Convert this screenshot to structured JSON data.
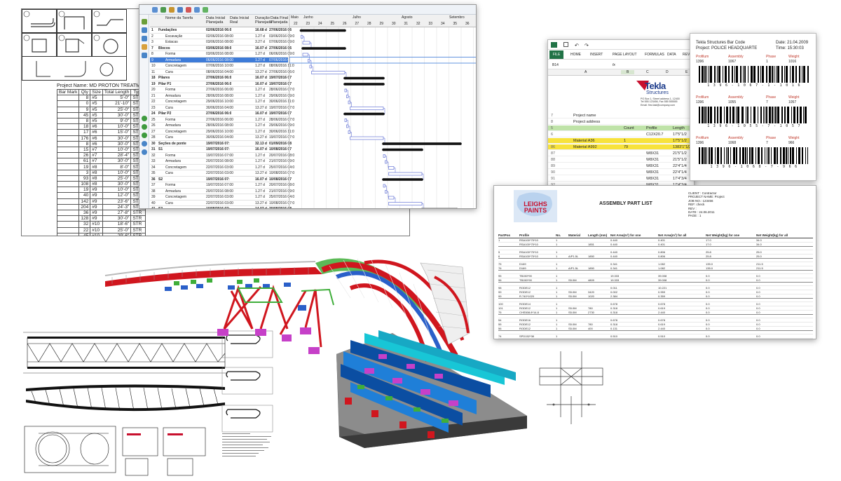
{
  "rebar_schedule": {
    "project_label": "Project Name:  MD PROTON TREATMENT CE",
    "headers": [
      "Bar Mark",
      "Qty",
      "Size",
      "Total Length",
      "Type"
    ],
    "rows": [
      [
        "",
        "8",
        "#5",
        "5'-0\"",
        "STR"
      ],
      [
        "",
        "0",
        "#5",
        "21'-10\"",
        "STR"
      ],
      [
        "",
        "9",
        "#5",
        "25'-0\"",
        "STR"
      ],
      [
        "",
        "45",
        "#5",
        "30'-0\"",
        "STR"
      ],
      [
        "",
        "8",
        "#5",
        "9'-0\"",
        "STR"
      ],
      [
        "",
        "18",
        "#6",
        "10'-0\"",
        "STR"
      ],
      [
        "",
        "17",
        "#6",
        "15'-0\"",
        "STR"
      ],
      [
        "",
        "176",
        "#6",
        "30'-0\"",
        "STR"
      ],
      [
        "",
        "8",
        "#6",
        "30'-0\"",
        "STR"
      ],
      [
        "",
        "15",
        "#7",
        "10'-0\"",
        "STR"
      ],
      [
        "",
        "26",
        "#7",
        "28'-4\"",
        "STR"
      ],
      [
        "",
        "61",
        "#7",
        "30'-0\"",
        "STR"
      ],
      [
        "",
        "19",
        "#8",
        "8'-0\"",
        "STR"
      ],
      [
        "",
        "3",
        "#8",
        "10'-0\"",
        "STR"
      ],
      [
        "",
        "93",
        "#8",
        "25'-0\"",
        "STR"
      ],
      [
        "",
        "108",
        "#8",
        "30'-0\"",
        "STR"
      ],
      [
        "",
        "19",
        "#9",
        "10'-0\"",
        "STR"
      ],
      [
        "",
        "40",
        "#9",
        "12'-0\"",
        "STR"
      ],
      [
        "",
        "142",
        "#9",
        "23'-6\"",
        "STR"
      ],
      [
        "",
        "204",
        "#9",
        "24'-3\"",
        "STR"
      ],
      [
        "",
        "36",
        "#9",
        "27'-8\"",
        "STR"
      ],
      [
        "",
        "128",
        "#9",
        "30'-0\"",
        "STR"
      ],
      [
        "",
        "32",
        "#10",
        "18'-6\"",
        "STR"
      ],
      [
        "",
        "22",
        "#10",
        "25'-0\"",
        "STR"
      ],
      [
        "",
        "45",
        "#10",
        "29'-6\"",
        "STR"
      ],
      [
        "G407",
        "10",
        "#4",
        "17'-9\"",
        "S10"
      ],
      [
        "G703",
        "12",
        "#7",
        "8'-2\"",
        "G703"
      ],
      [
        "G702",
        "9",
        "#7",
        "15'-7 1/2\"",
        "STR"
      ],
      [
        "G1004",
        "66",
        "#10",
        "22'-10\"",
        "STR"
      ],
      [
        "G1005",
        "18",
        "#10",
        "16'-7 1/2\"",
        "STR"
      ]
    ],
    "extra_cols": {
      "G703": [
        "1'-2\"",
        "-0\"",
        "2'-0\"",
        "5'-1 1/4\"",
        "5'-0\"",
        "",
        "",
        "0'-2 5/8\""
      ],
      "G702": [
        "",
        "",
        "",
        "",
        "",
        "3'-11 1/2\"",
        "4'-0\"",
        "0'-2 5/8\""
      ],
      "G1004": [
        "1'-10\"",
        "21'-0\"",
        "",
        "",
        "",
        "",
        "",
        "0'-5 3/8\""
      ],
      "G1005": [
        "",
        "5'-6\"",
        "5'-7 1/2\"",
        "5'-6\"",
        "",
        "4'-0\"",
        "4'-0\"",
        "0'-5 3/8\""
      ]
    }
  },
  "gantt": {
    "columns": [
      "Nome da Tarefa",
      "Data Inicial Planejada",
      "Data Inicial Real",
      "Duração Planejada",
      "Data Final Planejada"
    ],
    "months": [
      "Maio",
      "Junho",
      "Julho",
      "Agosto",
      "Setembro"
    ],
    "weeks": [
      "22",
      "23",
      "24",
      "25",
      "26",
      "27",
      "28",
      "29",
      "30",
      "31",
      "32",
      "33",
      "34",
      "35",
      "36"
    ],
    "rows": [
      {
        "id": "1",
        "name": "Fundações",
        "start": "02/06/2016 06:0",
        "dur": "16.68 d",
        "end": "27/06/2016 06",
        "sum": true
      },
      {
        "id": "2",
        "name": "Escavação",
        "start": "02/06/2016 08:00",
        "dur": "1.27 d",
        "end": "03/06/2016 09:0"
      },
      {
        "id": "3",
        "name": "Estacas",
        "start": "03/06/2016 08:00",
        "dur": "3.27 d",
        "end": "07/06/2016 09:0"
      },
      {
        "id": "7",
        "name": "Blocos",
        "start": "03/06/2016 08:0",
        "dur": "16.07 d",
        "end": "27/06/2016 06",
        "sum": true
      },
      {
        "id": "8",
        "name": "Forma",
        "start": "03/06/2016 08:00",
        "dur": "1.27 d",
        "end": "06/06/2016 09:0"
      },
      {
        "id": "9",
        "name": "Armadura",
        "start": "06/06/2016 08:00",
        "dur": "1.27 d",
        "end": "07/06/2016 09:0",
        "sel": true
      },
      {
        "id": "10",
        "name": "Concretagem",
        "start": "07/06/2016 10:00",
        "dur": "1.27 d",
        "end": "08/06/2016 11:0"
      },
      {
        "id": "11",
        "name": "Cura",
        "start": "08/06/2016 04:00",
        "dur": "13.27 d",
        "end": "27/06/2016 06:0"
      },
      {
        "id": "18",
        "name": "Pilares",
        "start": "27/06/2016 06:0",
        "dur": "16.07 d",
        "end": "19/07/2016 07",
        "sum": true
      },
      {
        "id": "19",
        "name": "Pilar P1",
        "start": "27/06/2016 06:0",
        "dur": "16.07 d",
        "end": "19/07/2016 07",
        "sum": true
      },
      {
        "id": "20",
        "name": "Forma",
        "start": "27/06/2016 06:00",
        "dur": "1.27 d",
        "end": "28/06/2016 07:0"
      },
      {
        "id": "21",
        "name": "Armadura",
        "start": "28/06/2016 08:00",
        "dur": "1.27 d",
        "end": "29/06/2016 09:0"
      },
      {
        "id": "22",
        "name": "Concretagem",
        "start": "29/06/2016 10:00",
        "dur": "1.27 d",
        "end": "30/06/2016 11:0"
      },
      {
        "id": "23",
        "name": "Cura",
        "start": "30/06/2016 04:00",
        "dur": "13.27 d",
        "end": "19/07/2016 07:0"
      },
      {
        "id": "24",
        "name": "Pilar P2",
        "start": "27/06/2016 06:0",
        "dur": "16.07 d",
        "end": "19/07/2016 07",
        "sum": true
      },
      {
        "id": "25",
        "name": "Forma",
        "start": "27/06/2016 06:00",
        "dur": "1.27 d",
        "end": "28/06/2016 07:0"
      },
      {
        "id": "26",
        "name": "Armadura",
        "start": "28/06/2016 08:00",
        "dur": "1.27 d",
        "end": "29/06/2016 09:0"
      },
      {
        "id": "27",
        "name": "Concretagem",
        "start": "29/06/2016 10:00",
        "dur": "1.27 d",
        "end": "30/06/2016 11:0"
      },
      {
        "id": "28",
        "name": "Cura",
        "start": "30/06/2016 04:00",
        "dur": "13.27 d",
        "end": "19/07/2016 07:0"
      },
      {
        "id": "30",
        "name": "Seções de ponte",
        "start": "19/07/2016 07:",
        "dur": "32.13 d",
        "end": "01/09/2016 08",
        "sum": true
      },
      {
        "id": "31",
        "name": "S1",
        "start": "19/07/2016 07:",
        "dur": "16.07 d",
        "end": "10/08/2016 07",
        "sum": true
      },
      {
        "id": "32",
        "name": "Forma",
        "start": "19/07/2016 07:00",
        "dur": "1.27 d",
        "end": "20/07/2016 08:0"
      },
      {
        "id": "33",
        "name": "Armadura",
        "start": "20/07/2016 08:00",
        "dur": "1.27 d",
        "end": "21/07/2016 09:0"
      },
      {
        "id": "34",
        "name": "Concretagem",
        "start": "22/07/2016 03:00",
        "dur": "1.27 d",
        "end": "25/07/2016 04:0"
      },
      {
        "id": "35",
        "name": "Cura",
        "start": "22/07/2016 03:00",
        "dur": "13.27 d",
        "end": "10/08/2016 07:0"
      },
      {
        "id": "36",
        "name": "S2",
        "start": "19/07/2016 07:",
        "dur": "16.07 d",
        "end": "10/08/2016 07",
        "sum": true
      },
      {
        "id": "37",
        "name": "Forma",
        "start": "19/07/2016 07:00",
        "dur": "1.27 d",
        "end": "20/07/2016 08:0"
      },
      {
        "id": "38",
        "name": "Armadura",
        "start": "20/07/2016 08:00",
        "dur": "1.27 d",
        "end": "21/07/2016 09:0"
      },
      {
        "id": "39",
        "name": "Concretagem",
        "start": "22/07/2016 03:00",
        "dur": "1.27 d",
        "end": "25/07/2016 04:0"
      },
      {
        "id": "40",
        "name": "Cura",
        "start": "22/07/2016 03:00",
        "dur": "13.27 d",
        "end": "10/08/2016 07:0"
      },
      {
        "id": "41",
        "name": "S3",
        "start": "10/08/2016 07:",
        "dur": "14.07 d",
        "end": "30/08/2016 08",
        "sum": true
      },
      {
        "id": "42",
        "name": "Forma",
        "start": "10/08/2016 07:00",
        "dur": "1.27 d",
        "end": "11/08/2016 08:0"
      },
      {
        "id": "43",
        "name": "Armadura",
        "start": "11/08/2016 08:00",
        "dur": "1.27 d",
        "end": "12/08/2016 09:0"
      },
      {
        "id": "44",
        "name": "Concretagem",
        "start": "12/08/2016 10:00",
        "dur": "1.27 d",
        "end": "15/08/2016 11:0"
      },
      {
        "id": "45",
        "name": "Cura",
        "start": "15/08/2016 04:00",
        "dur": "13.27 d",
        "end": "30/08/2016 08:0"
      }
    ]
  },
  "excel": {
    "file_tab": "FILE",
    "tabs": [
      "HOME",
      "INSERT",
      "PAGE LAYOUT",
      "FORMULAS",
      "DATA",
      "REV"
    ],
    "name_box": "B14",
    "fx": "fx",
    "columns": [
      "A",
      "B",
      "C",
      "D",
      "E"
    ],
    "brand": "Tekla",
    "brand_sub": "Structures",
    "address": [
      "PO Box 1, Street address 1, 12400",
      "Tel 555 123456, Fax 555 555555",
      "Email: first.last@company.com"
    ],
    "rows": [
      {
        "n": "7",
        "cells": [
          "Project name"
        ]
      },
      {
        "n": "8",
        "cells": [
          "Project address"
        ]
      },
      {
        "n": "5",
        "cells": [
          "",
          "Count",
          "Profile",
          "Length",
          "Width"
        ],
        "style": "grn"
      },
      {
        "n": "6",
        "cells": [
          "",
          "",
          "C12X20.7",
          "17'5\"1/2",
          "1,3"
        ]
      },
      {
        "n": "",
        "cells": [
          "Material  A36",
          "1",
          "",
          "17'5\"1/2",
          "1,3"
        ],
        "style": "yel"
      },
      {
        "n": "86",
        "cells": [
          "Material  A992",
          "79",
          "",
          "1383'1\"1/2",
          "93,7"
        ],
        "style": "yel"
      },
      {
        "n": "87",
        "cells": [
          "",
          "",
          "W8X31",
          "21'5\"1/2",
          ""
        ]
      },
      {
        "n": "88",
        "cells": [
          "",
          "",
          "W8X31",
          "21'5\"1/2",
          ""
        ]
      },
      {
        "n": "89",
        "cells": [
          "",
          "",
          "W8X31",
          "22'4\"1/4",
          ""
        ]
      },
      {
        "n": "90",
        "cells": [
          "",
          "",
          "W8X31",
          "22'4\"1/4",
          ""
        ]
      },
      {
        "n": "91",
        "cells": [
          "",
          "",
          "W8X31",
          "17'4\"3/4",
          ""
        ]
      },
      {
        "n": "92",
        "cells": [
          "",
          "",
          "W8X31",
          "17'4\"3/4",
          ""
        ]
      },
      {
        "n": "93",
        "cells": [
          "Material  A1085",
          "8",
          "",
          "122'4\"3/4",
          "4,1"
        ],
        "style": "yel"
      },
      {
        "n": "94",
        "cells": [
          "",
          "",
          "ROD3/4\"",
          "1'8\"",
          ""
        ]
      }
    ]
  },
  "barcode": {
    "title": "Tekla Structures Bar Code",
    "project": "Project:  POLICE HEADQUARTE",
    "date": "Date: 21.04.2009",
    "time": "Time:  15:30:03",
    "labels": [
      "Profilum",
      "Assembly",
      "Phase",
      "Weight"
    ],
    "entries": [
      {
        "vals": [
          "1396",
          "1067",
          "1",
          "1016"
        ],
        "code": "1 3 9 6 - 1 0 6 7 - 1 - 1 0 1 6"
      },
      {
        "vals": [
          "1396",
          "1055",
          "7",
          "1057"
        ],
        "code": "1 3 9 6 - 1 0 5 5 - 7 - 1 0 5 7"
      },
      {
        "vals": [
          "1396",
          "1068",
          "7",
          "966"
        ],
        "code": "1 3 9 6 - 1 0 6 8 - 7 - 9 6 6"
      }
    ]
  },
  "assembly": {
    "brand": "LEIGHS PAINTS",
    "title": "ASSEMBLY PART LIST",
    "info": [
      "CLIENT : Contractor",
      "PROJECT NAME: Project",
      "JOB NO.: 123456",
      "REF: check",
      "REV :",
      "DATE : 24.06.2011",
      "PAGE : 1"
    ],
    "headers": [
      "PartPos",
      "Profile",
      "No.",
      "Material",
      "Length (mm)",
      "Net Area(m²) for one",
      "Net Area(m²) for all",
      "Net Weight(kg) for one",
      "Net Weight(kg) for all"
    ],
    "groups": [
      [
        [
          "1",
          "RSA100*75*10",
          "1",
          "",
          "",
          "0.440",
          "0.401",
          "17.0",
          "34.0"
        ],
        [
          "",
          "RSA100*75*10",
          "1",
          "",
          "1851",
          "0.440",
          "0.401",
          "17.0",
          "34.0"
        ]
      ],
      [
        [
          "5",
          "RSA100*75*10",
          "1",
          "",
          "",
          "0.440",
          "0.806",
          "25.8",
          "25.0"
        ],
        [
          "6",
          "RSA100*75*10",
          "1",
          "A/P1.5L",
          "1850",
          "0.440",
          "0.806",
          "25.8",
          "25.0"
        ]
      ],
      [
        [
          "75",
          "D169",
          "1",
          "",
          "",
          "0.341",
          "1.082",
          "135.0",
          "211.5"
        ],
        [
          "76",
          "D169",
          "1",
          "A/P1.5L",
          "1850",
          "0.341",
          "1.082",
          "135.0",
          "211.5"
        ]
      ],
      [
        [
          "95",
          "TB150*90",
          "1",
          "",
          "",
          "19.333",
          "39.008",
          "0.0",
          "0.0"
        ],
        [
          "96",
          "TB150*90",
          "1",
          "S5.0M",
          "4809",
          "19.333",
          "39.008",
          "0.0",
          "0.0"
        ]
      ],
      [
        [
          "98",
          "RODE12",
          "1",
          "",
          "",
          "0.011",
          "10.221",
          "0.0",
          "0.0"
        ],
        [
          "99",
          "RODE12",
          "1",
          "S5.0M",
          "3420",
          "0.002",
          "0.959",
          "0.0",
          "0.0"
        ],
        [
          "99",
          "R.740*1020",
          "1",
          "S5.0M",
          "1020",
          "2.384",
          "0.359",
          "0.0",
          "0.0"
        ]
      ],
      [
        [
          "100",
          "RODE14",
          "1",
          "",
          "",
          "0.678",
          "0.678",
          "0.0",
          "0.0"
        ],
        [
          "101",
          "RODE12",
          "1",
          "S5.0M",
          "780",
          "0.318",
          "0.619",
          "0.0",
          "0.0"
        ],
        [
          "75",
          "CHS508.8*14.8",
          "1",
          "S5.0M",
          "2730",
          "0.318",
          "2.440",
          "0.0",
          "0.0"
        ]
      ],
      [
        [
          "54",
          "RODE16",
          "1",
          "",
          "",
          "0.678",
          "0.678",
          "0.0",
          "0.0"
        ],
        [
          "55",
          "RODE12",
          "1",
          "S5.0M",
          "780",
          "0.318",
          "0.619",
          "0.0",
          "0.0"
        ],
        [
          "56",
          "RODE12",
          "1",
          "S5.0M",
          "400",
          "0.131",
          "2.440",
          "0.0",
          "0.0"
        ]
      ],
      [
        [
          "74",
          "SPD152*38",
          "1",
          "",
          "",
          "0.510",
          "0.510",
          "0.0",
          "0.0"
        ],
        [
          "75",
          "SPD152*38",
          "1",
          "S5.0M",
          "2545",
          "0.510",
          "0.510",
          "0.0",
          "0.0"
        ]
      ]
    ]
  },
  "colors": {
    "excel_green": "#217346",
    "tekla_red": "#c8102e",
    "highlight_yellow": "#f7e23b",
    "gantt_select": "#3d7bd8",
    "model_red": "#d0161e",
    "model_green": "#3fae3a",
    "model_blue": "#2a5fc9",
    "model_cyan": "#18c6d6",
    "model_magenta": "#c640c8"
  }
}
